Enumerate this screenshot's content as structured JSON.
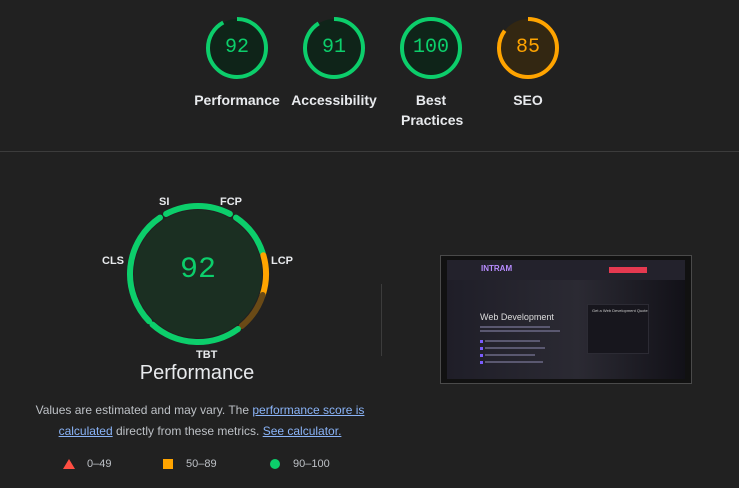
{
  "colors": {
    "pass": "#0cce6b",
    "average": "#ffa400",
    "fail": "#ff4e42",
    "pass_track": "#0b2c1b",
    "average_track": "#3a2a10"
  },
  "categories": [
    {
      "name": "Performance",
      "score": "92",
      "status": "pass"
    },
    {
      "name": "Accessibility",
      "score": "91",
      "status": "pass"
    },
    {
      "name": "Best Practices",
      "score": "100",
      "status": "pass"
    },
    {
      "name": "SEO",
      "score": "85",
      "status": "average"
    }
  ],
  "performance": {
    "score": "92",
    "title": "Performance",
    "metrics": [
      {
        "label": "SI"
      },
      {
        "label": "FCP"
      },
      {
        "label": "LCP"
      },
      {
        "label": "TBT"
      },
      {
        "label": "CLS"
      }
    ]
  },
  "note": {
    "prefix": "Values are estimated and may vary. The ",
    "link1": "performance score is calculated",
    "middle": " directly from these metrics. ",
    "link2": "See calculator."
  },
  "legend": [
    {
      "range": "0–49",
      "icon": "triangle-icon",
      "color": "#ff4e42"
    },
    {
      "range": "50–89",
      "icon": "square-icon",
      "color": "#ffa400"
    },
    {
      "range": "90–100",
      "icon": "circle-icon",
      "color": "#0cce6b"
    }
  ],
  "screenshot": {
    "logo": "INTRAM",
    "hero_title": "Web Development",
    "card_title": "Get a Web Development Quote"
  }
}
